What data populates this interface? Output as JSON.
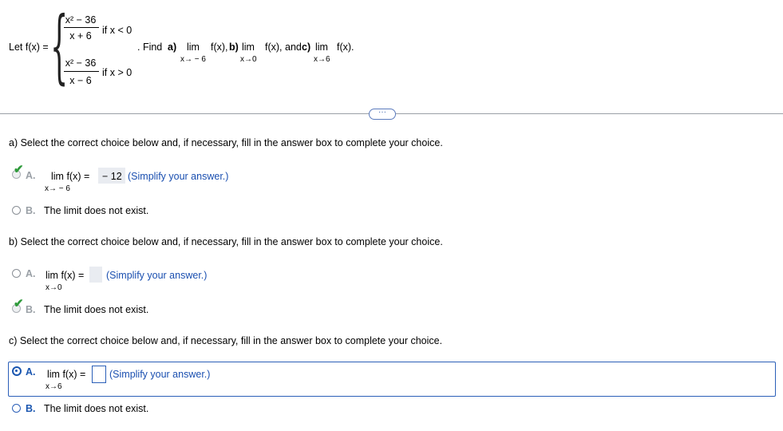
{
  "problem": {
    "let_label": "Let f(x) =",
    "piece1": {
      "num": "x² − 36",
      "den": "x + 6",
      "cond": "if x < 0"
    },
    "piece2": {
      "num": "x² − 36",
      "den": "x − 6",
      "cond": "if x > 0"
    },
    "find_text": ". Find",
    "part_a_label": "a)",
    "part_b_label": "b)",
    "part_c_label": "c)",
    "lim": "lim",
    "fx": "f(x),",
    "fx_and": "f(x), and",
    "fx_end": "f(x).",
    "sub_a": "x→ − 6",
    "sub_b": "x→0",
    "sub_c": "x→6"
  },
  "more_button": "···",
  "questions": {
    "a": {
      "prompt": "a) Select the correct choice below and, if necessary, fill in the answer box to complete your choice.",
      "choice_a_letter": "A.",
      "choice_a_lim": "lim  f(x) =",
      "choice_a_sub": "x→ − 6",
      "choice_a_value": "− 12",
      "choice_a_hint": "(Simplify your answer.)",
      "choice_b_letter": "B.",
      "choice_b_text": "The limit does not exist."
    },
    "b": {
      "prompt": "b) Select the correct choice below and, if necessary, fill in the answer box to complete your choice.",
      "choice_a_letter": "A.",
      "choice_a_lim": "lim  f(x) =",
      "choice_a_sub": "x→0",
      "choice_a_value": "",
      "choice_a_hint": "(Simplify your answer.)",
      "choice_b_letter": "B.",
      "choice_b_text": "The limit does not exist."
    },
    "c": {
      "prompt": "c) Select the correct choice below and, if necessary, fill in the answer box to complete your choice.",
      "choice_a_letter": "A.",
      "choice_a_lim": "lim  f(x) =",
      "choice_a_sub": "x→6",
      "choice_a_value": "",
      "choice_a_hint": "(Simplify your answer.)",
      "choice_b_letter": "B.",
      "choice_b_text": "The limit does not exist."
    }
  },
  "colors": {
    "accent": "#1a56b0",
    "check": "#2e9a3a",
    "separator": "#9aa0a6"
  }
}
